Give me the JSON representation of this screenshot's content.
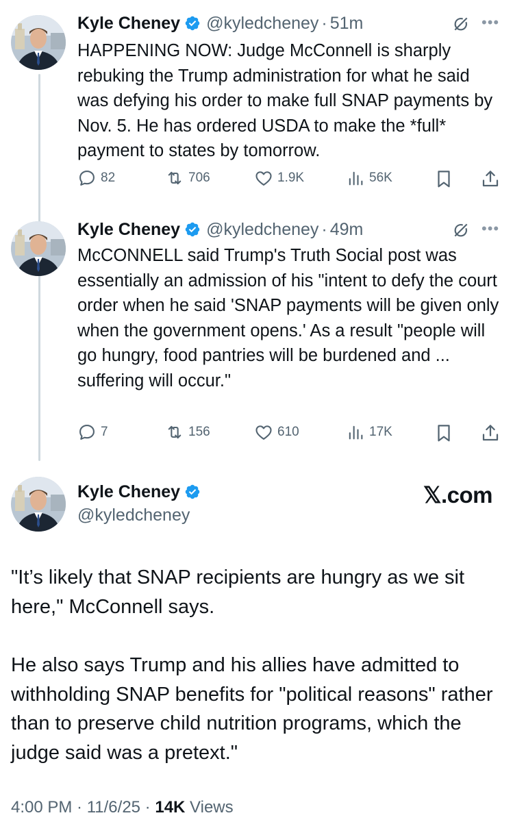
{
  "tweets": [
    {
      "name": "Kyle Cheney",
      "handle": "@kyledcheney",
      "time": "51m",
      "text": "HAPPENING NOW: Judge McConnell is sharply rebuking the Trump administration for what he said was defying his order to make full SNAP payments by Nov. 5. He has ordered  USDA to make the *full* payment to states by tomorrow.",
      "replies": "82",
      "reposts": "706",
      "likes": "1.9K",
      "views": "56K"
    },
    {
      "name": "Kyle Cheney",
      "handle": "@kyledcheney",
      "time": "49m",
      "text": "McCONNELL said Trump's Truth Social post was essentially an admission of his \"intent to defy the court order when he said 'SNAP payments will be given only when the government opens.' As a result \"people will go hungry, food pantries will be burdened and ... suffering will occur.\"",
      "replies": "7",
      "reposts": "156",
      "likes": "610",
      "views": "17K"
    }
  ],
  "main": {
    "name": "Kyle Cheney",
    "handle": "@kyledcheney",
    "brand": "𝕏.com",
    "paragraph1": "\"It’s likely that SNAP recipients are hungry as we sit here,\" McConnell says.",
    "paragraph2": "He also says Trump and his allies have admitted to withholding SNAP benefits for \"political reasons\" rather than to preserve child nutrition programs, which the judge said was a pretext.\"",
    "time": "4:00 PM",
    "date": "11/6/25",
    "views_count": "14K",
    "views_label": "Views"
  },
  "icons": {
    "verified": "verified-badge-icon",
    "grok": "grok-icon",
    "more": "more-icon",
    "reply": "reply-icon",
    "repost": "repost-icon",
    "like": "like-icon",
    "views": "views-icon",
    "bookmark": "bookmark-icon",
    "share": "share-icon"
  },
  "colors": {
    "verified": "#1d9bf0",
    "text": "#0f1419",
    "secondary": "#536471",
    "thread_line": "#cfd9de"
  }
}
